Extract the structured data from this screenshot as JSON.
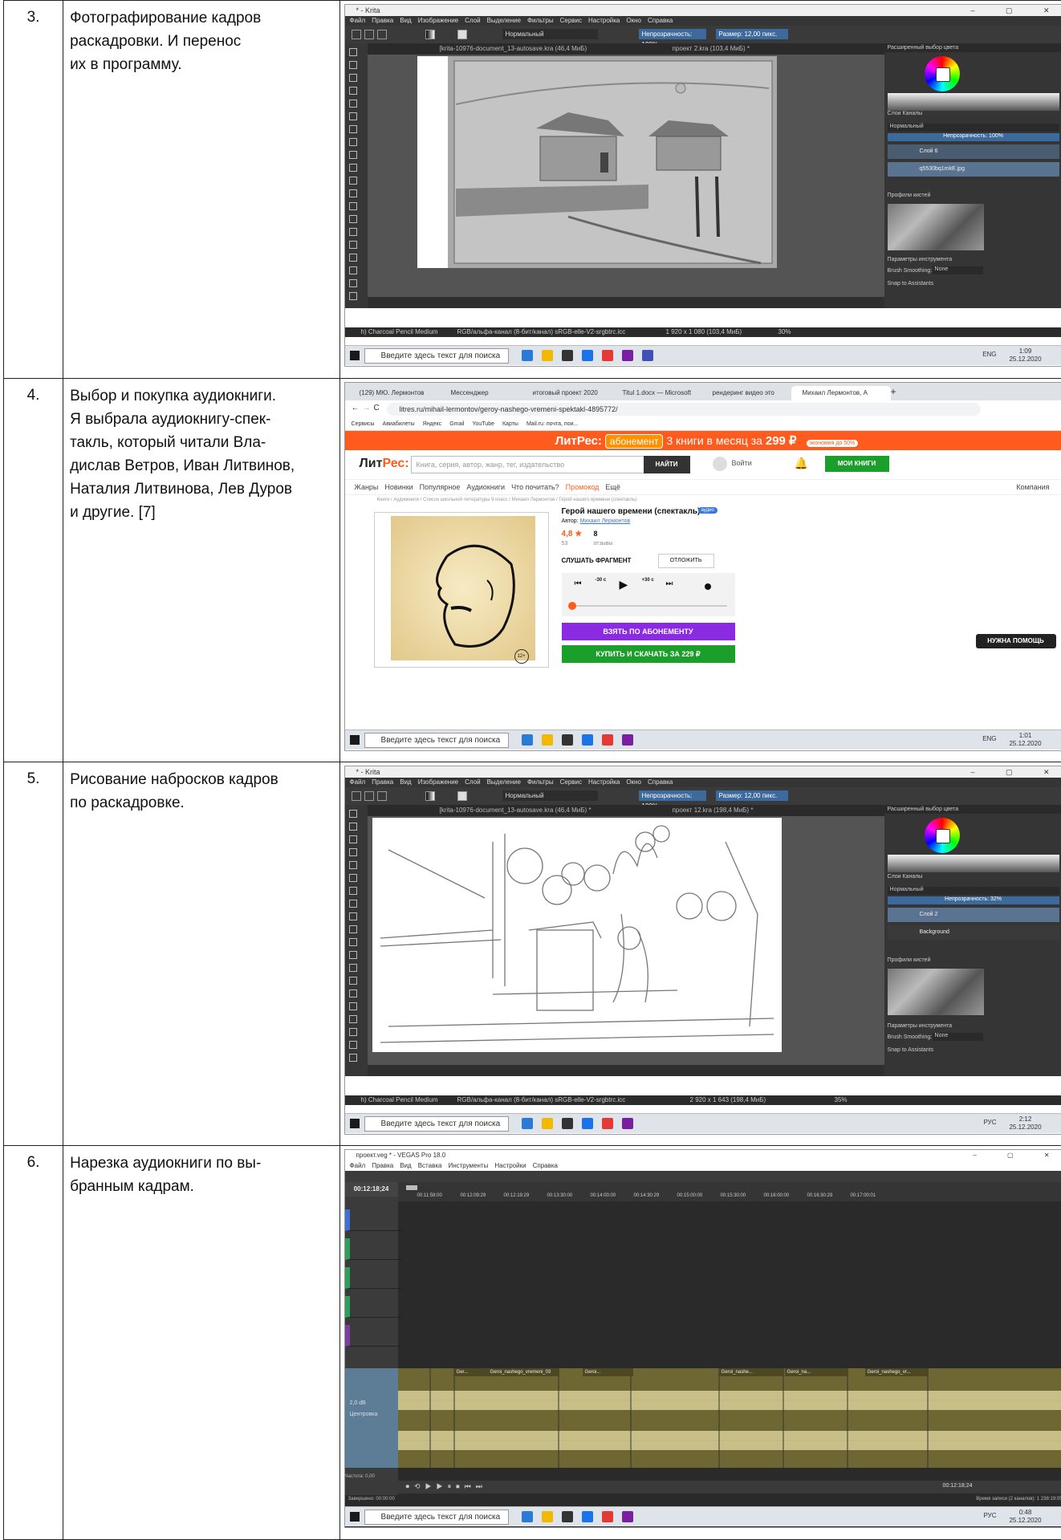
{
  "rows": [
    {
      "num": "3.",
      "lines": [
        "Фотографирование кадров",
        "раскадровки. И перенос",
        "их в программу."
      ],
      "shot": {
        "kind": "krita",
        "title": "* - Krita",
        "menu": [
          "Файл",
          "Правка",
          "Вид",
          "Изображение",
          "Слой",
          "Выделение",
          "Фильтры",
          "Сервис",
          "Настройка",
          "Окно",
          "Справка"
        ],
        "blend": "Нормальный",
        "opacity": "Непрозрачность: 100%",
        "size": "Размер: 12,00 пикс.",
        "tab1": "[krita-10976-document_13-autosave.kra (46,4 МиБ)",
        "tab2": "проект 2.kra (103,4 МиБ) *",
        "dock_title": "Расширенный выбор цвета",
        "layers_tabs": "Слои  Каналы",
        "layer_mode": "Нормальный",
        "layer_opacity": "Непрозрачность: 100%",
        "layers": [
          "Слой 6",
          "q5530bq1mkE.jpg"
        ],
        "presets": "Профили кистей",
        "tool_params": "Параметры инструмента",
        "smoothing": "Brush Smoothing:",
        "smoothing_val": "None",
        "snap": "Snap to Assistants",
        "status_brush": "h) Charcoal Pencil Medium",
        "status_color": "RGB/альфа-канал (8-бит/канал)  sRGB-elle-V2-srgbtrc.icc",
        "status_size": "1 920 x 1 080 (103,4 МиБ)",
        "zoom": "30%",
        "search": "Введите здесь текст для поиска",
        "lang": "ENG",
        "time": "1:09",
        "date": "25.12.2020"
      }
    },
    {
      "num": "4.",
      "lines": [
        "Выбор и покупка аудиокниги.",
        "Я выбрала аудиокнигу-спек-",
        "такль, который читали Вла-",
        "дислав Ветров, Иван Литвинов,",
        "Наталия Литвинова, Лев Дуров",
        "и другие.  [7]"
      ],
      "shot": {
        "kind": "browser",
        "tabs": [
          "(129) МЮ. Лермонтов",
          "Мессенджер",
          "итоговый проект 2020",
          "Titul 1.docx — Microsoft",
          "рендеринг видео это",
          "Михаил Лермонтов, А"
        ],
        "url": "litres.ru/mihail-lermontov/geroy-nashego-vremeni-spektakl-4895772/",
        "bookmarks": [
          "Сервисы",
          "Авиабилеты",
          "Яндекс",
          "Gmail",
          "YouTube",
          "Карты",
          "Mail.ru: почта, пои..."
        ],
        "banner_brand": "ЛитРес:",
        "banner_pill": "абонемент",
        "banner_text": "3 книги в месяц за",
        "banner_price": "299 ₽",
        "banner_badge": "экономия до 50%",
        "logo_a": "Лит",
        "logo_b": "Рес:",
        "search_ph": "Книга, серия, автор, жанр, тег, издательство",
        "find": "НАЙТИ",
        "login": "Войти",
        "mybooks": "МОИ КНИГИ",
        "nav": [
          "Жанры",
          "Новинки",
          "Популярное",
          "Аудиокниги",
          "Что почитать?",
          "Промокод",
          "Ещё"
        ],
        "company": "Компания",
        "crumbs": "Книги / Аудиокниги / Список школьной литературы 9 класс / Михаил Лермонтов / Герой нашего времени (спектакль)",
        "book_title": "Герой нашего времени (спектакль)",
        "audio_badge": "аудио",
        "author_label": "Автор:",
        "author": "Михаил Лермонтов",
        "rating": "4,8 ★",
        "votes": "53",
        "reviews": "8",
        "reviews_label": "отзывы",
        "listen": "СЛУШАТЬ ФРАГМЕНТ",
        "defer": "ОТЛОЖИТЬ",
        "skip_back": "-30 с",
        "skip_fwd": "+30 с",
        "age": "12+",
        "subscribe": "ВЗЯТЬ ПО АБОНЕМЕНТУ",
        "buy": "КУПИТЬ И СКАЧАТЬ ЗА 229 ₽",
        "help": "НУЖНА ПОМОЩЬ",
        "search": "Введите здесь текст для поиска",
        "lang": "ENG",
        "time": "1:01",
        "date": "25.12.2020"
      }
    },
    {
      "num": "5.",
      "lines": [
        "Рисование набросков кадров",
        "по раскадровке."
      ],
      "shot": {
        "kind": "krita",
        "title": "* - Krita",
        "menu": [
          "Файл",
          "Правка",
          "Вид",
          "Изображение",
          "Слой",
          "Выделение",
          "Фильтры",
          "Сервис",
          "Настройка",
          "Окно",
          "Справка"
        ],
        "blend": "Нормальный",
        "opacity": "Непрозрачность: 100%",
        "size": "Размер: 12,00 пикс.",
        "tab1": "[krita-10976-document_13-autosave.kra (46,4 МиБ) *",
        "tab2": "проект 12.kra (198,4 МиБ) *",
        "dock_title": "Расширенный выбор цвета",
        "layers_tabs": "Слои  Каналы",
        "layer_mode": "Нормальный",
        "layer_opacity": "Непрозрачность: 32%",
        "layers": [
          "Слой 2",
          "Background"
        ],
        "presets": "Профили кистей",
        "tool_params": "Параметры инструмента",
        "smoothing": "Brush Smoothing:",
        "smoothing_val": "None",
        "snap": "Snap to Assistants",
        "status_brush": "h) Charcoal Pencil Medium",
        "status_color": "RGB/альфа-канал (8-бит/канал)  sRGB-elle-V2-srgbtrc.icc",
        "status_size": "2 920 x 1 643 (198,4 МиБ)",
        "zoom": "35%",
        "search": "Введите здесь текст для поиска",
        "lang": "РУС",
        "time": "2:12",
        "date": "25.12.2020"
      }
    },
    {
      "num": "6.",
      "lines": [
        "Нарезка аудиокниги по вы-",
        "бранным кадрам."
      ],
      "shot": {
        "kind": "vegas",
        "title": "проект.veg * - VEGAS Pro 18.0",
        "menu": [
          "Файл",
          "Правка",
          "Вид",
          "Вставка",
          "Инструменты",
          "Настройки",
          "Справка"
        ],
        "timecode": "00:12:18;24",
        "ruler": [
          "00:11:58:00",
          "00:12:09:29",
          "00:12:19:29",
          "00:13:30:00",
          "00:14:00:00",
          "00:14:30:29",
          "00:15:00:00",
          "00:15:30:00",
          "00:16:00:00",
          "00:16:30:29",
          "00:17:00:01"
        ],
        "audio_db": "2,0 dB",
        "audio_label": "Центровка",
        "clips": [
          "Ger...",
          "Geroi_nashego_vremeni_03",
          "Geroi...",
          "Geroi_nashe...",
          "Geroi_na...",
          "Geroi_nashego_vr..."
        ],
        "rate": "Частота: 0,00",
        "done": "Завершено: 00:00:00",
        "cursor_time": "00:12:18;24",
        "rec_time": "Время записи (2 каналов): 1 238:19:05",
        "search": "Введите здесь текст для поиска",
        "lang": "РУС",
        "time": "0:48",
        "date": "25.12.2020"
      }
    }
  ]
}
